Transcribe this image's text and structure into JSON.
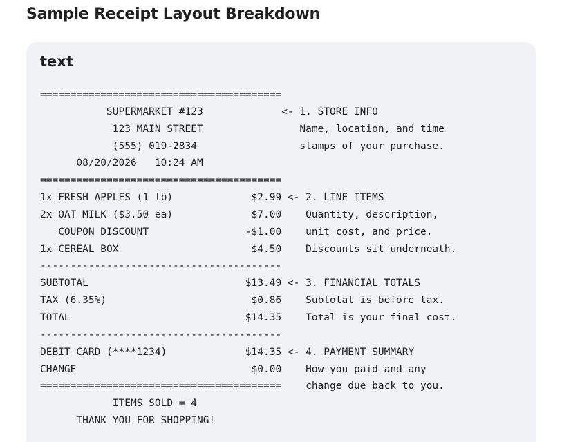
{
  "heading": "Sample Receipt Layout Breakdown",
  "code_language": "text",
  "code_lines": [
    "========================================",
    "           SUPERMARKET #123             <- 1. STORE INFO",
    "            123 MAIN STREET                Name, location, and time",
    "            (555) 019-2834                 stamps of your purchase.",
    "      08/20/2026   10:24 AM",
    "========================================",
    "1x FRESH APPLES (1 lb)             $2.99 <- 2. LINE ITEMS",
    "2x OAT MILK ($3.50 ea)             $7.00    Quantity, description,",
    "   COUPON DISCOUNT                -$1.00    unit cost, and price.",
    "1x CEREAL BOX                      $4.50    Discounts sit underneath.",
    "----------------------------------------",
    "SUBTOTAL                          $13.49 <- 3. FINANCIAL TOTALS",
    "TAX (6.35%)                        $0.86    Subtotal is before tax.",
    "TOTAL                             $14.35    Total is your final cost.",
    "----------------------------------------",
    "DEBIT CARD (****1234)             $14.35 <- 4. PAYMENT SUMMARY",
    "CHANGE                             $0.00    How you paid and any",
    "========================================    change due back to you.",
    "            ITEMS SOLD = 4",
    "      THANK YOU FOR SHOPPING!"
  ]
}
